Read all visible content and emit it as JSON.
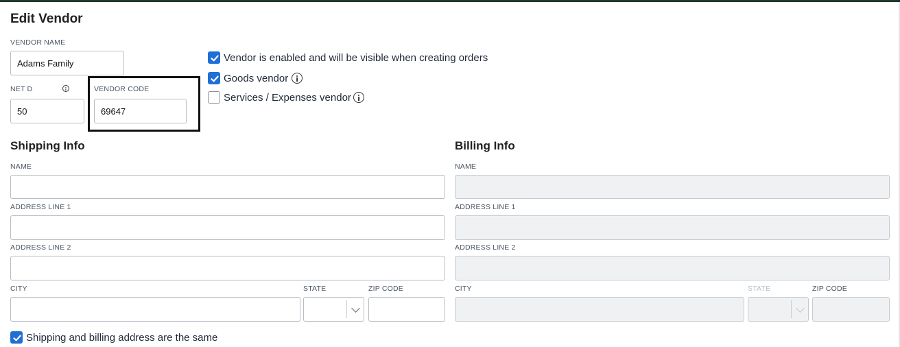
{
  "page": {
    "title": "Edit Vendor"
  },
  "vendor": {
    "name_label": "VENDOR NAME",
    "name_value": "Adams Family",
    "netd_label": "NET D",
    "netd_value": "50",
    "code_label": "VENDOR CODE",
    "code_value": "69647"
  },
  "options": {
    "enabled_label": "Vendor is enabled and will be visible when creating orders",
    "enabled_checked": true,
    "goods_label": "Goods vendor",
    "goods_checked": true,
    "services_label": "Services / Expenses vendor",
    "services_checked": false
  },
  "shipping": {
    "title": "Shipping Info",
    "name_label": "NAME",
    "name_value": "",
    "address1_label": "ADDRESS LINE 1",
    "address1_value": "",
    "address2_label": "ADDRESS LINE 2",
    "address2_value": "",
    "city_label": "CITY",
    "city_value": "",
    "state_label": "STATE",
    "state_value": "",
    "zip_label": "ZIP CODE",
    "zip_value": ""
  },
  "billing": {
    "title": "Billing Info",
    "name_label": "NAME",
    "name_value": "",
    "address1_label": "ADDRESS LINE 1",
    "address1_value": "",
    "address2_label": "ADDRESS LINE 2",
    "address2_value": "",
    "city_label": "CITY",
    "city_value": "",
    "state_label": "STATE",
    "state_value": "",
    "zip_label": "ZIP CODE",
    "zip_value": ""
  },
  "same_address": {
    "label": "Shipping and billing address are the same",
    "checked": true
  },
  "icons": {
    "info": "info-circle-icon",
    "check": "checkmark-icon",
    "chevron": "chevron-down-icon"
  },
  "colors": {
    "accent": "#1f6fd6",
    "topbar": "#1f3a2a",
    "disabled_bg": "#f0f1f3"
  }
}
